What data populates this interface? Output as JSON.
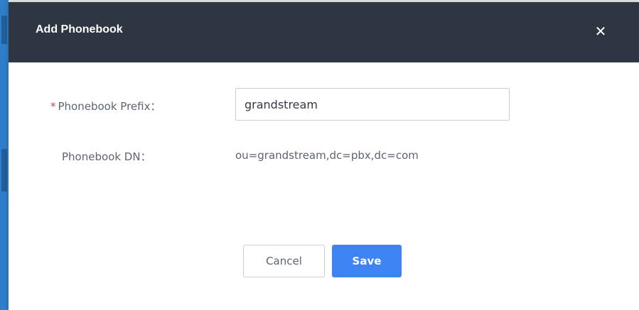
{
  "modal": {
    "title": "Add Phonebook",
    "close_icon": "close-icon"
  },
  "form": {
    "prefix_required_marker": "*",
    "prefix_label": "Phonebook Prefix：",
    "prefix_value": "grandstream",
    "dn_label": "Phonebook DN：",
    "dn_value": "ou=grandstream,dc=pbx,dc=com"
  },
  "buttons": {
    "cancel_label": "Cancel",
    "save_label": "Save"
  },
  "colors": {
    "header_bg": "#2e3642",
    "primary": "#3d84f2",
    "required": "#e6444f"
  }
}
